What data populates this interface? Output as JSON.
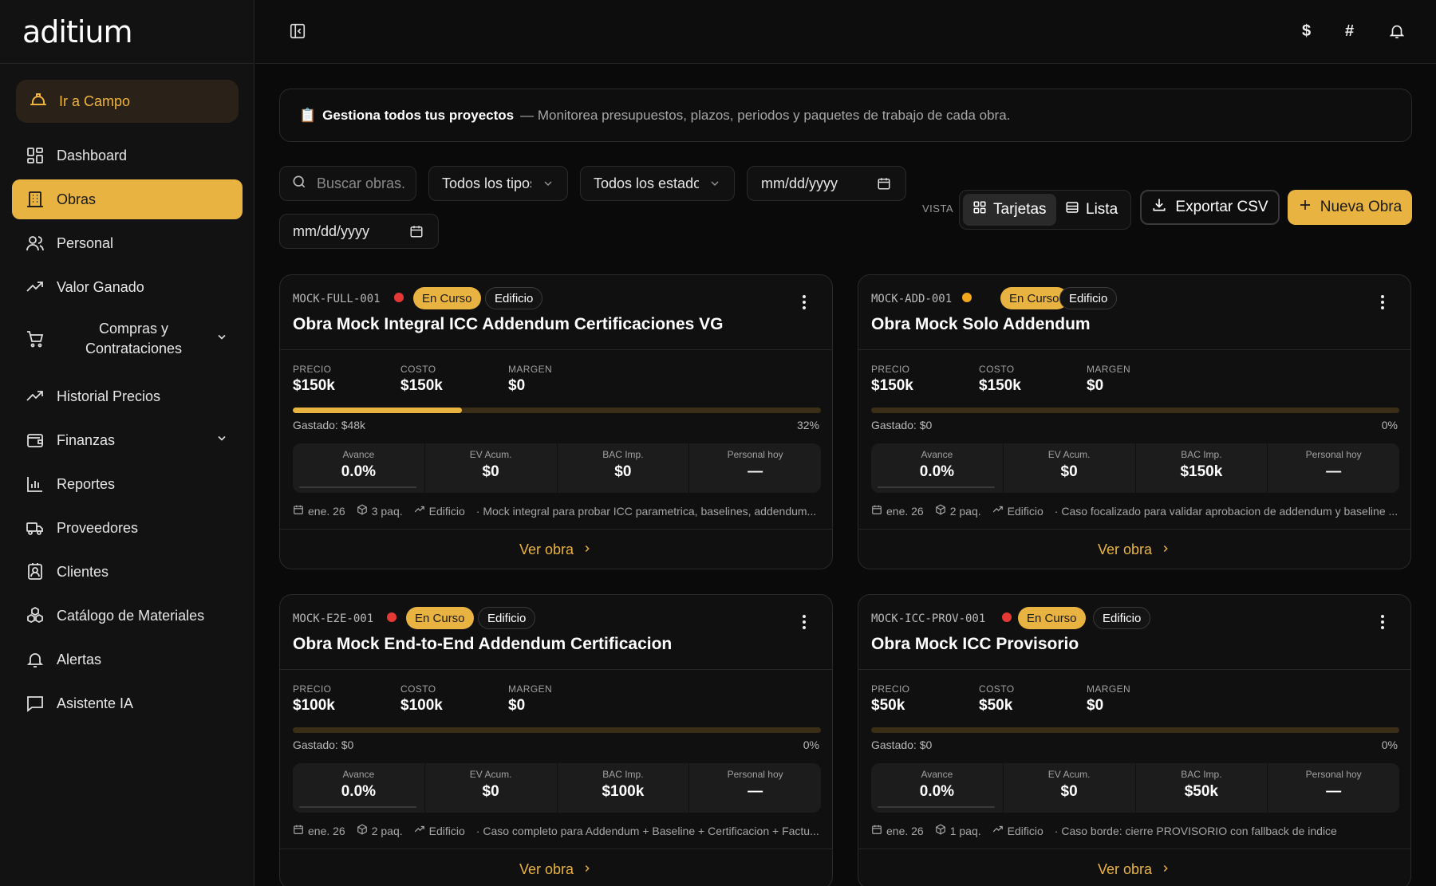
{
  "brand": {
    "logo": "aditium",
    "accent": "#e9b342"
  },
  "sidebar": {
    "campo_button": "Ir a Campo",
    "items": [
      {
        "label": "Dashboard",
        "icon": "dashboard-icon"
      },
      {
        "label": "Obras",
        "icon": "building-icon",
        "active": true
      },
      {
        "label": "Personal",
        "icon": "users-icon"
      },
      {
        "label": "Valor Ganado",
        "icon": "trending-icon"
      },
      {
        "label": "Compras y Contrataciones",
        "icon": "cart-icon",
        "expandable": true
      },
      {
        "label": "Historial Precios",
        "icon": "trending-icon"
      },
      {
        "label": "Finanzas",
        "icon": "wallet-icon",
        "expandable": true
      },
      {
        "label": "Reportes",
        "icon": "bar-chart-icon"
      },
      {
        "label": "Proveedores",
        "icon": "truck-icon"
      },
      {
        "label": "Clientes",
        "icon": "contact-icon"
      },
      {
        "label": "Catálogo de Materiales",
        "icon": "boxes-icon"
      },
      {
        "label": "Alertas",
        "icon": "bell-icon"
      },
      {
        "label": "Asistente IA",
        "icon": "chat-icon"
      }
    ]
  },
  "topbar": {
    "icons": [
      "dollar-icon",
      "hash-icon",
      "bell-icon"
    ],
    "dollar": "$",
    "hash": "#"
  },
  "banner": {
    "emoji": "📋",
    "title": "Gestiona todos tus proyectos",
    "description": "— Monitorea presupuestos, plazos, periodos y paquetes de trabajo de cada obra."
  },
  "filters": {
    "search_placeholder": "Buscar obras...",
    "type_select": "Todos los tipos",
    "status_select": "Todos los estados",
    "date_from": "mm/dd/yyyy",
    "date_to": "mm/dd/yyyy",
    "vista_label": "VISTA",
    "view_cards": "Tarjetas",
    "view_list": "Lista",
    "export": "Exportar CSV",
    "new_obra": "Nueva Obra"
  },
  "card_labels": {
    "precio": "PRECIO",
    "costo": "COSTO",
    "margen": "MARGEN",
    "avance": "Avance",
    "ev": "EV Acum.",
    "bac": "BAC Imp.",
    "personal": "Personal hoy",
    "ver_obra": "Ver obra"
  },
  "obras": [
    {
      "code": "MOCK-FULL-001",
      "dot_color": "#e53935",
      "status": "En Curso",
      "type": "Edificio",
      "title": "Obra Mock Integral ICC Addendum Certificaciones VG",
      "precio": "$150k",
      "costo": "$150k",
      "margen": "$0",
      "gastado": "Gastado: $48k",
      "pct": "32%",
      "progress": 0.32,
      "avance": "0.0%",
      "ev": "$0",
      "bac": "$0",
      "personal": "—",
      "date": "ene. 26",
      "paquetes": "3 paq.",
      "tipo": "Edificio",
      "desc": "· Mock integral para probar ICC parametrica, baselines, addendum..."
    },
    {
      "code": "MOCK-ADD-001",
      "dot_color": "#f2a81d",
      "status": "En Curso",
      "type": "Edificio",
      "title": "Obra Mock Solo Addendum",
      "precio": "$150k",
      "costo": "$150k",
      "margen": "$0",
      "gastado": "Gastado: $0",
      "pct": "0%",
      "progress": 0,
      "avance": "0.0%",
      "ev": "$0",
      "bac": "$150k",
      "personal": "—",
      "date": "ene. 26",
      "paquetes": "2 paq.",
      "tipo": "Edificio",
      "desc": "· Caso focalizado para validar aprobacion de addendum y baseline ..."
    },
    {
      "code": "MOCK-E2E-001",
      "dot_color": "#e53935",
      "status": "En Curso",
      "type": "Edificio",
      "title": "Obra Mock End-to-End Addendum Certificacion",
      "precio": "$100k",
      "costo": "$100k",
      "margen": "$0",
      "gastado": "Gastado: $0",
      "pct": "0%",
      "progress": 0,
      "avance": "0.0%",
      "ev": "$0",
      "bac": "$100k",
      "personal": "—",
      "date": "ene. 26",
      "paquetes": "2 paq.",
      "tipo": "Edificio",
      "desc": "· Caso completo para Addendum + Baseline + Certificacion + Factu..."
    },
    {
      "code": "MOCK-ICC-PROV-001",
      "dot_color": "#e53935",
      "status": "En Curso",
      "type": "Edificio",
      "title": "Obra Mock ICC Provisorio",
      "precio": "$50k",
      "costo": "$50k",
      "margen": "$0",
      "gastado": "Gastado: $0",
      "pct": "0%",
      "progress": 0,
      "avance": "0.0%",
      "ev": "$0",
      "bac": "$50k",
      "personal": "—",
      "date": "ene. 26",
      "paquetes": "1 paq.",
      "tipo": "Edificio",
      "desc": "· Caso borde: cierre PROVISORIO con fallback de indice"
    }
  ]
}
